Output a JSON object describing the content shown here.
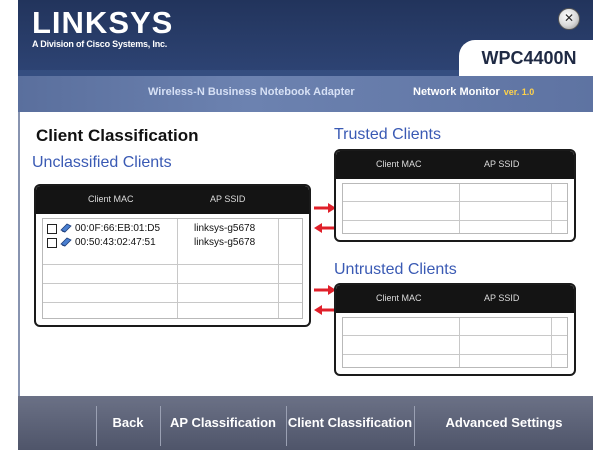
{
  "app": {
    "brand": "LINKSYS",
    "brand_tagline": "A Division of Cisco Systems, Inc.",
    "model": "WPC4400N",
    "product_name": "Wireless-N Business Notebook Adapter",
    "utility_name": "Network Monitor",
    "version": "ver. 1.0"
  },
  "page": {
    "title": "Client Classification"
  },
  "unclassified": {
    "title": "Unclassified Clients",
    "columns": [
      "Client MAC",
      "AP SSID"
    ],
    "rows": [
      {
        "mac": "00:0F:66:EB:01:D5",
        "ssid": "linksys-g5678"
      },
      {
        "mac": "00:50:43:02:47:51",
        "ssid": "linksys-g5678"
      }
    ]
  },
  "trusted": {
    "title": "Trusted Clients",
    "columns": [
      "Client MAC",
      "AP SSID"
    ]
  },
  "untrusted": {
    "title": "Untrusted Clients",
    "columns": [
      "Client MAC",
      "AP SSID"
    ]
  },
  "footer": {
    "back": "Back",
    "ap_classification": "AP Classification",
    "client_classification": "Client Classification",
    "advanced_settings": "Advanced Settings"
  },
  "colors": {
    "accent_blue": "#3a5ab4",
    "arrow_red": "#e0202a",
    "header_navy": "#2a3f6e"
  },
  "icons": {
    "close": "close-x-icon",
    "device": "wireless-device-icon",
    "arrow_right": "arrow-right-icon",
    "arrow_left": "arrow-left-icon"
  }
}
